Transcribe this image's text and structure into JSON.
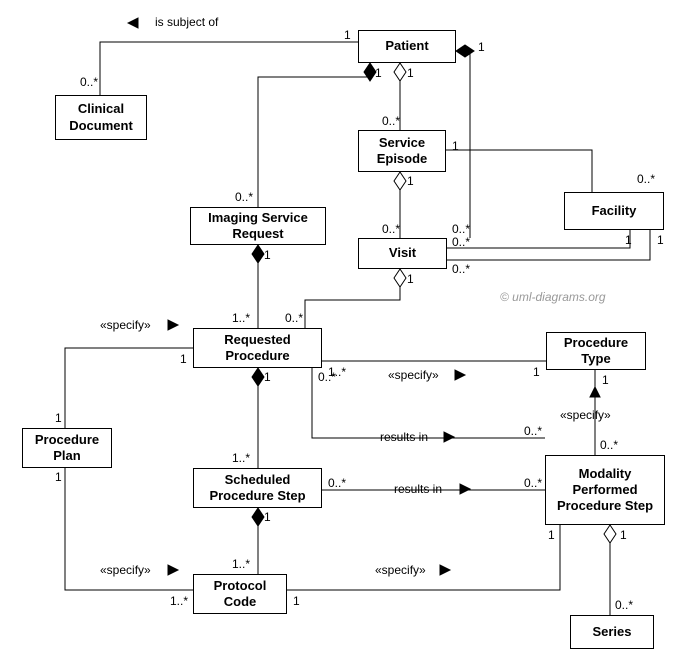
{
  "classes": {
    "patient": "Patient",
    "clinicalDocument": "Clinical\nDocument",
    "serviceEpisode": "Service\nEpisode",
    "facility": "Facility",
    "imagingServiceRequest": "Imaging Service\nRequest",
    "visit": "Visit",
    "requestedProcedure": "Requested\nProcedure",
    "procedureType": "Procedure\nType",
    "procedurePlan": "Procedure\nPlan",
    "scheduledProcedureStep": "Scheduled\nProcedure Step",
    "modalityPerformedProcedureStep": "Modality\nPerformed\nProcedure Step",
    "protocolCode": "Protocol\nCode",
    "series": "Series"
  },
  "labels": {
    "isSubjectOf": "is subject of",
    "specify": "«specify»",
    "resultsIn": "results in"
  },
  "mult": {
    "one": "1",
    "zeroStar": "0..*",
    "oneStar": "1..*"
  },
  "copyright": "© uml-diagrams.org"
}
